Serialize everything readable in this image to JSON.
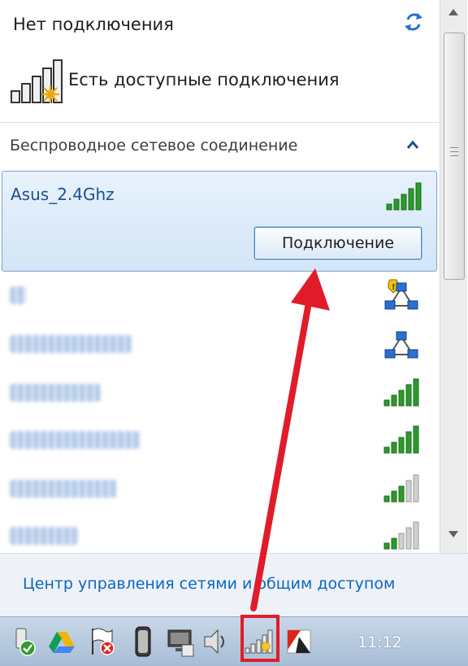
{
  "popup": {
    "title": "Нет подключения",
    "status": "Есть доступные подключения",
    "section": "Беспроводное сетевое соединение"
  },
  "selected_network": {
    "ssid": "Asus_2.4Ghz",
    "signal_bars": 5,
    "connect_label": "Подключение"
  },
  "networks": [
    {
      "label_blurred": true,
      "signal": "shield-network",
      "signal_bars": null
    },
    {
      "label_blurred": true,
      "signal": "network-icon",
      "signal_bars": null
    },
    {
      "label_blurred": true,
      "signal": "wifi",
      "signal_bars": 5
    },
    {
      "label_blurred": true,
      "signal": "wifi",
      "signal_bars": 5
    },
    {
      "label_blurred": true,
      "signal": "wifi",
      "signal_bars": 3
    },
    {
      "label_blurred": true,
      "signal": "wifi",
      "signal_bars": 2
    }
  ],
  "footer": {
    "link": "Центр управления сетями и общим доступом"
  },
  "taskbar": {
    "clock": "11:12",
    "tray_icons": [
      "usb-safe-remove-icon",
      "google-drive-icon",
      "action-center-flag-icon",
      "battery-icon",
      "display-icon",
      "volume-icon",
      "wifi-no-connection-icon",
      "app-icon"
    ]
  },
  "colors": {
    "highlight_red": "#e01c2a",
    "link_blue": "#0d66c2",
    "signal_green": "#2c9a2c",
    "signal_grey": "#9a9a9a"
  }
}
